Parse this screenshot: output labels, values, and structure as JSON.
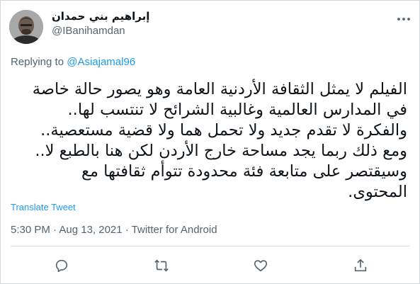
{
  "author": {
    "display_name": "إبراهيم بني حمدان",
    "handle": "@IBanihamdan"
  },
  "reply": {
    "prefix": "Replying to",
    "mention": "@Asiajamal96"
  },
  "tweet": {
    "lines": [
      "الفيلم لا يمثل الثقافة الأردنية العامة وهو يصور حالة خاصة",
      "في المدارس العالمية وغالبية الشرائح لا تنتسب لها..",
      "والفكرة لا تقدم جديد ولا تحمل هما ولا قضية مستعصية..",
      "ومع ذلك ربما يجد مساحة خارج الأردن لكن هنا بالطبع لا..",
      "وسيقتصر على متابعة فئة محدودة تتوأم ثقافتها مع",
      "المحتوى."
    ]
  },
  "translate_label": "Translate Tweet",
  "meta": "5:30 PM · Aug 13, 2021 · Twitter for Android",
  "actions": [
    "reply-icon",
    "retweet-icon",
    "like-icon",
    "share-icon"
  ],
  "colors": {
    "accent": "#1d9bf0",
    "secondary": "#536471",
    "text": "#0f1419",
    "border": "#cfd9de"
  }
}
